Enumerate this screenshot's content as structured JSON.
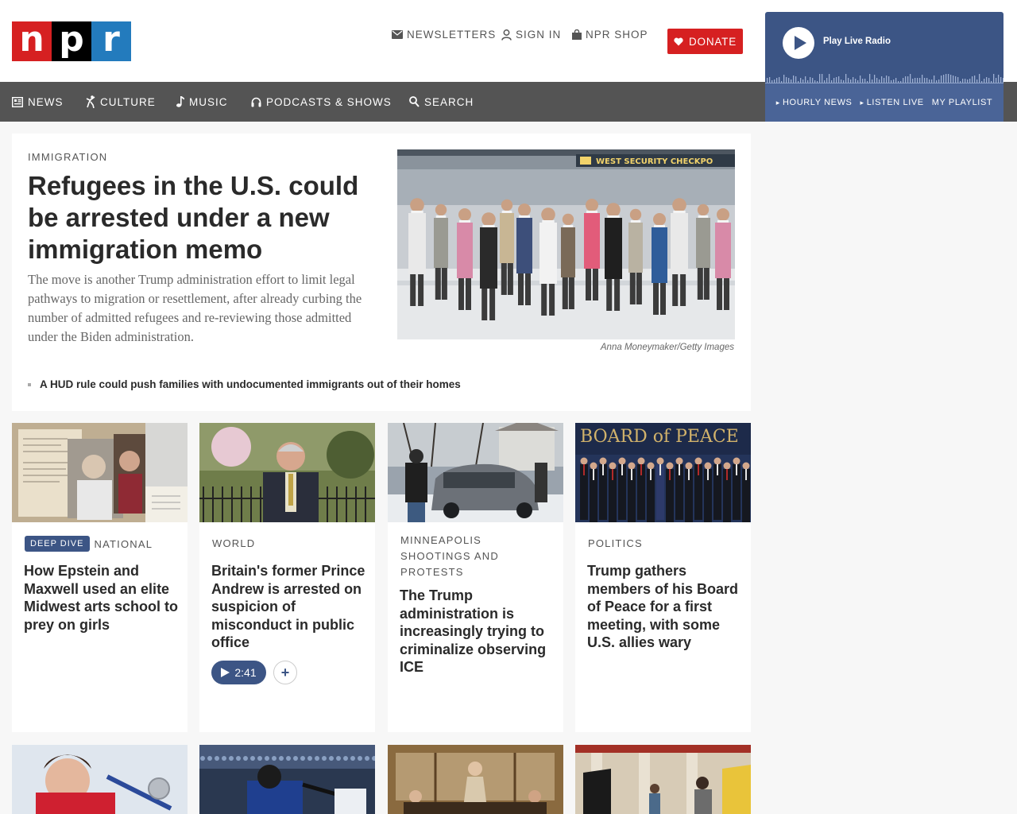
{
  "logo": {
    "letters": [
      "n",
      "p",
      "r"
    ],
    "colors": [
      "#d62021",
      "#000000",
      "#237bbd"
    ]
  },
  "utility": {
    "newsletters": "NEWSLETTERS",
    "sign_in": "SIGN IN",
    "shop": "NPR SHOP",
    "donate": "DONATE"
  },
  "nav": {
    "news": "NEWS",
    "culture": "CULTURE",
    "music": "MUSIC",
    "podcasts": "PODCASTS & SHOWS",
    "search": "SEARCH"
  },
  "player": {
    "title": "Play Live Radio",
    "hourly": "HOURLY NEWS",
    "listen": "LISTEN LIVE",
    "playlist": "MY PLAYLIST"
  },
  "feature": {
    "kicker": "IMMIGRATION",
    "headline": "Refugees in the U.S. could be arrested under a new immigration memo",
    "teaser": "The move is another Trump administration effort to limit legal pathways to migration or resettlement, after already curbing the number of admitted refugees and re-reviewing those admitted under the Biden administration.",
    "related": "A HUD rule could push families with undocumented immigrants out of their homes",
    "credit": "Anna Moneymaker/Getty Images",
    "sign_text": "WEST SECURITY CHECKPO"
  },
  "cards": [
    {
      "badge": "DEEP DIVE",
      "kicker": "NATIONAL",
      "headline": "How Epstein and Maxwell used an elite Midwest arts school to prey on girls"
    },
    {
      "kicker": "WORLD",
      "headline": "Britain's former Prince Andrew is arrested on suspicion of misconduct in public office",
      "duration": "2:41"
    },
    {
      "kicker": "MINNEAPOLIS SHOOTINGS AND PROTESTS",
      "headline": "The Trump administration is increasingly trying to criminalize observing ICE"
    },
    {
      "kicker": "POLITICS",
      "headline": "Trump gathers members of his Board of Peace for a first meeting, with some U.S. allies wary",
      "image_text": "BOARD of PEACE"
    }
  ],
  "colors": {
    "accent_blue": "#3c5585",
    "donate_red": "#d62021",
    "nav_gray": "#545454"
  }
}
